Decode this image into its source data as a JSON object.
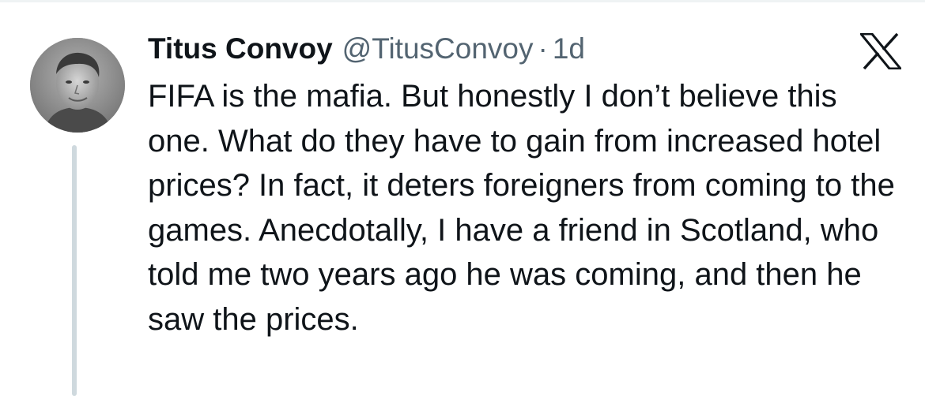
{
  "tweet": {
    "author": {
      "display_name": "Titus Convoy",
      "handle": "@TitusConvoy",
      "avatar": "profile-photo"
    },
    "separator": "·",
    "timestamp": "1d",
    "platform_icon": "x-logo-icon",
    "text": "FIFA is the mafia. But honestly I don’t believe this one. What do they have to gain from increased hotel prices? In fact, it deters foreigners from coming to the games. Anecdotally, I have a friend in Scotland, who told me two years ago he was coming, and then he saw the prices."
  },
  "colors": {
    "primary_text": "#0f1419",
    "secondary_text": "#536471",
    "thread_line": "#cfd9de",
    "background": "#ffffff"
  }
}
